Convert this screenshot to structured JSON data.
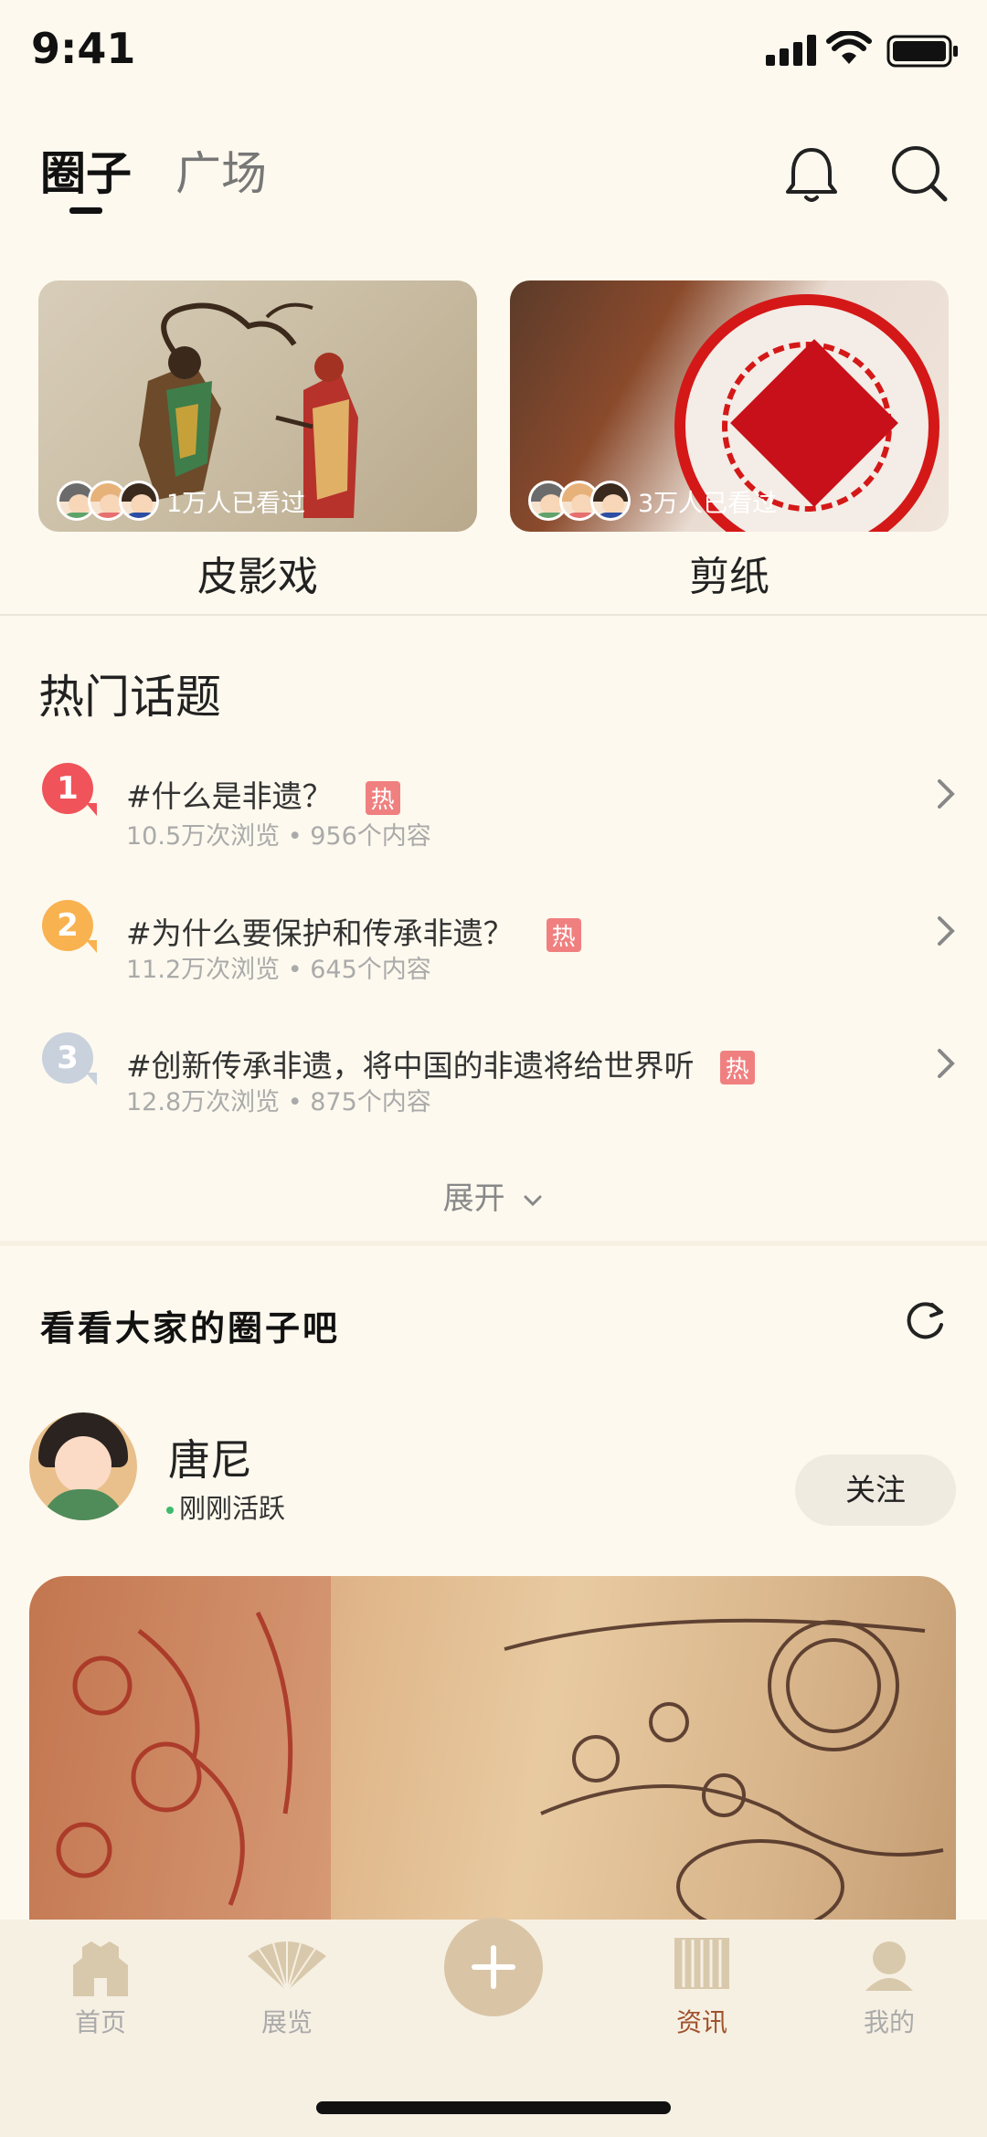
{
  "status_bar": {
    "time": "9:41"
  },
  "header": {
    "tabs": [
      {
        "label": "圈子",
        "active": true
      },
      {
        "label": "广场",
        "active": false
      }
    ]
  },
  "circles": [
    {
      "title": "皮影戏",
      "viewers_text": "1万人已看过"
    },
    {
      "title": "剪纸",
      "viewers_text": "3万人已看过"
    }
  ],
  "hot_topics": {
    "title": "热门话题",
    "hot_badge": "热",
    "items": [
      {
        "rank": "1",
        "title": "#什么是非遗？",
        "meta": "10.5万次浏览 • 956个内容",
        "color": "#f0535a"
      },
      {
        "rank": "2",
        "title": "#为什么要保护和传承非遗？",
        "meta": "11.2万次浏览 • 645个内容",
        "color": "#f9b250"
      },
      {
        "rank": "3",
        "title": "#创新传承非遗，将中国的非遗将给世界听",
        "meta": "12.8万次浏览 • 875个内容",
        "color": "#c8d1dc"
      }
    ],
    "expand_label": "展开"
  },
  "circles_feed": {
    "title": "看看大家的圈子吧",
    "user": {
      "name": "唐尼",
      "status": "刚刚活跃",
      "follow_label": "关注"
    }
  },
  "nav": {
    "items": [
      {
        "label": "首页",
        "active": false
      },
      {
        "label": "展览",
        "active": false
      },
      {
        "label": "资讯",
        "active": true
      },
      {
        "label": "我的",
        "active": false
      }
    ]
  },
  "colors": {
    "background": "#fdf9ee",
    "accent": "#a0522d",
    "hot_badge": "#f08080"
  }
}
